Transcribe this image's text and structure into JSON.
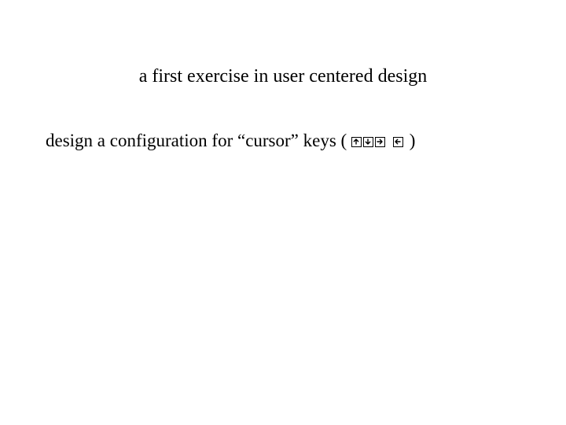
{
  "title": "a first exercise in user centered design",
  "body": {
    "prefix": "design a configuration for “cursor” keys (",
    "suffix": ")"
  },
  "keys": [
    {
      "name": "arrow-up-key"
    },
    {
      "name": "arrow-down-key"
    },
    {
      "name": "arrow-right-key"
    },
    {
      "name": "arrow-left-key"
    }
  ]
}
